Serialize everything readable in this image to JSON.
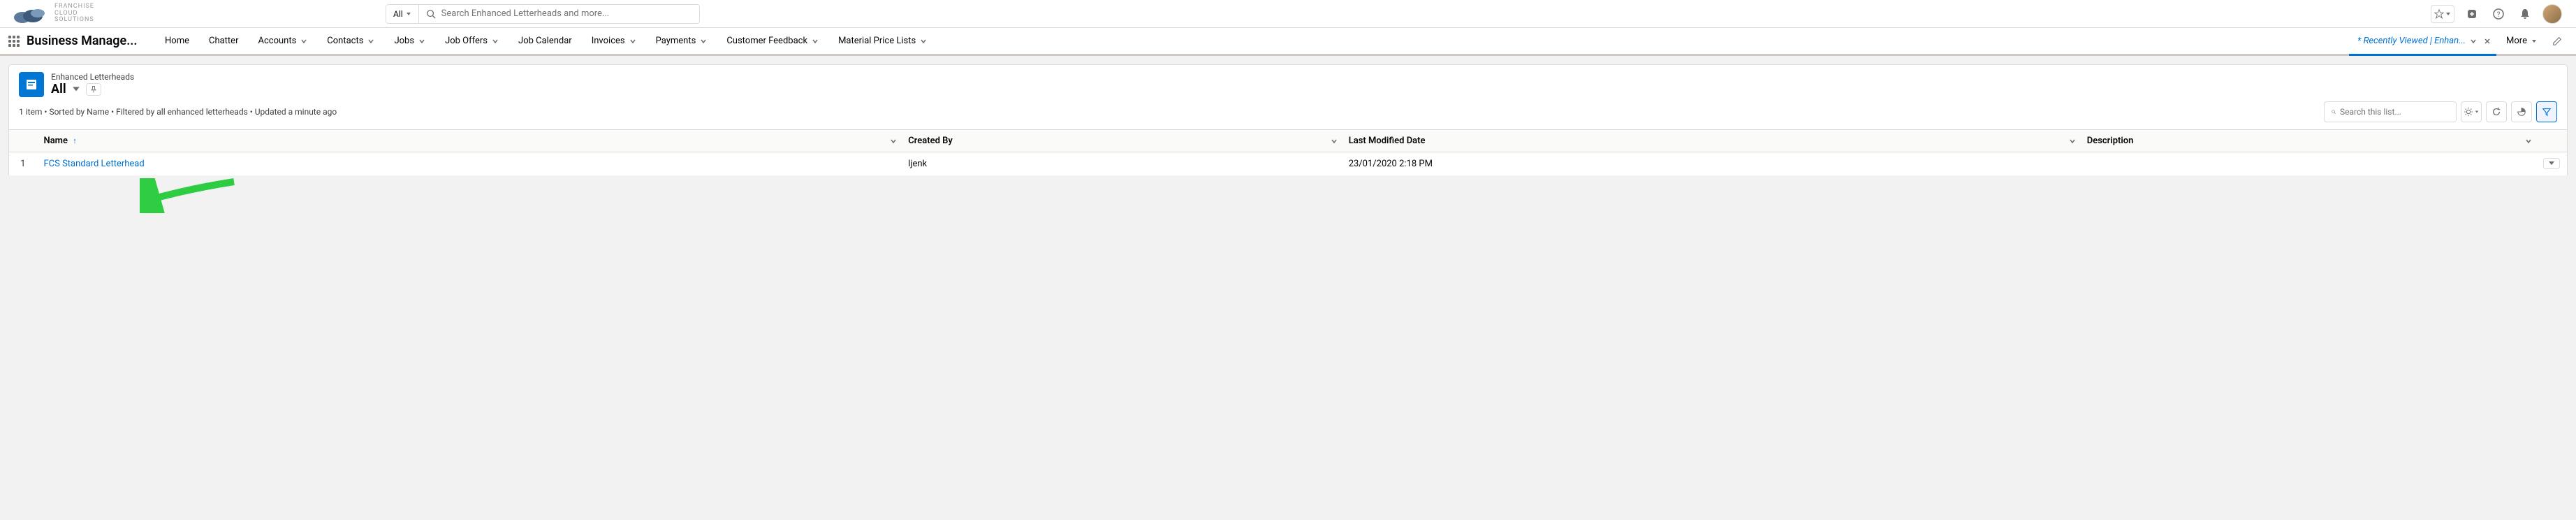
{
  "logo": {
    "line1": "FRANCHISE",
    "line2": "CLOUD",
    "line3": "SOLUTIONS"
  },
  "header": {
    "search_scope": "All",
    "search_placeholder": "Search Enhanced Letterheads and more..."
  },
  "app": {
    "name": "Business Manage..."
  },
  "nav": {
    "items": [
      {
        "label": "Home",
        "dd": false
      },
      {
        "label": "Chatter",
        "dd": false
      },
      {
        "label": "Accounts",
        "dd": true
      },
      {
        "label": "Contacts",
        "dd": true
      },
      {
        "label": "Jobs",
        "dd": true
      },
      {
        "label": "Job Offers",
        "dd": true
      },
      {
        "label": "Job Calendar",
        "dd": false
      },
      {
        "label": "Invoices",
        "dd": true
      },
      {
        "label": "Payments",
        "dd": true
      },
      {
        "label": "Customer Feedback",
        "dd": true
      },
      {
        "label": "Material Price Lists",
        "dd": true
      }
    ],
    "current_tab": "* Recently Viewed | Enhan...",
    "more": "More"
  },
  "object": {
    "type": "Enhanced Letterheads",
    "view": "All"
  },
  "list_meta": "1 item • Sorted by Name • Filtered by all enhanced letterheads • Updated a minute ago",
  "list_search_placeholder": "Search this list...",
  "columns": {
    "name": "Name",
    "created_by": "Created By",
    "last_modified": "Last Modified Date",
    "description": "Description"
  },
  "rows": [
    {
      "num": "1",
      "name": "FCS Standard Letterhead",
      "created_by": "ljenk",
      "last_modified": "23/01/2020 2:18 PM",
      "description": ""
    }
  ]
}
